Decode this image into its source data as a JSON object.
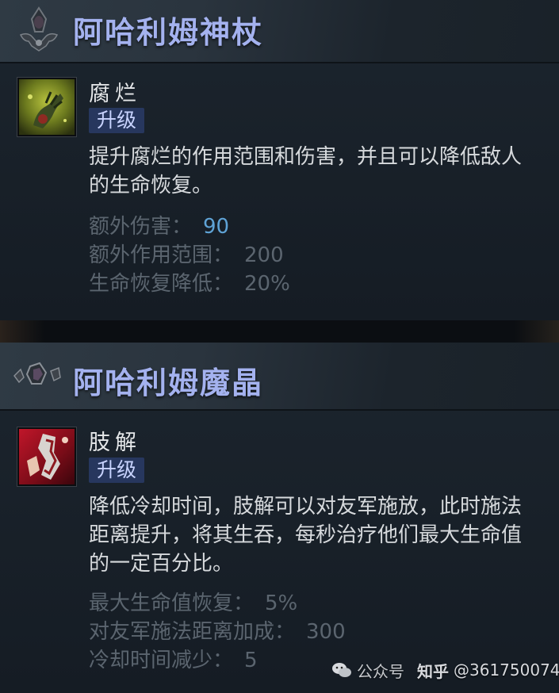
{
  "panels": {
    "scepter": {
      "title": "阿哈利姆神杖",
      "header_icon": "aghanims-scepter-icon",
      "ability_name": "腐烂",
      "ability_icon": "rot-ability-icon",
      "badge": "升级",
      "description": "提升腐烂的作用范围和伤害，并且可以降低敌人的生命恢复。",
      "stats": [
        {
          "label": "额外伤害：",
          "value": "90"
        },
        {
          "label": "额外作用范围：",
          "value": "200"
        },
        {
          "label": "生命恢复降低：",
          "value": "20%"
        }
      ]
    },
    "shard": {
      "title": "阿哈利姆魔晶",
      "header_icon": "aghanims-shard-icon",
      "ability_name": "肢解",
      "ability_icon": "dismember-ability-icon",
      "badge": "升级",
      "description": "降低冷却时间，肢解可以对友军施放，此时施法距离提升，将其生吞，每秒治疗他们最大生命值的一定百分比。",
      "stats": [
        {
          "label": "最大生命值恢复：",
          "value": "5%"
        },
        {
          "label": "对友军施法距离加成：",
          "value": "300"
        },
        {
          "label": "冷却时间减少：",
          "value": "5"
        }
      ]
    }
  },
  "watermark": {
    "account": "公众号",
    "site": "知乎",
    "handle": "@361750074"
  },
  "colors": {
    "title": "#a4b2ef",
    "badge_bg": "#27375e",
    "highlight_value": "#5fa3d6",
    "stat_text": "#5b656f"
  }
}
